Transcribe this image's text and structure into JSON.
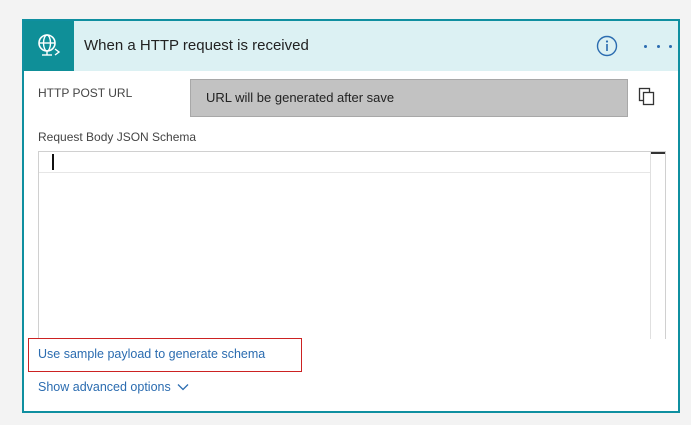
{
  "card": {
    "title": "When a HTTP request is received",
    "accent_color": "#0f8f98",
    "header_bg": "#dcf1f3"
  },
  "icons": {
    "trigger": "globe-request-icon",
    "info": "info-icon",
    "more": "ellipsis-icon",
    "copy": "copy-icon",
    "chevron": "chevron-down-icon"
  },
  "url": {
    "label": "HTTP POST URL",
    "value": "URL will be generated after save"
  },
  "schema": {
    "label": "Request Body JSON Schema",
    "value": ""
  },
  "links": {
    "sample_payload": "Use sample payload to generate schema",
    "advanced": "Show advanced options"
  }
}
